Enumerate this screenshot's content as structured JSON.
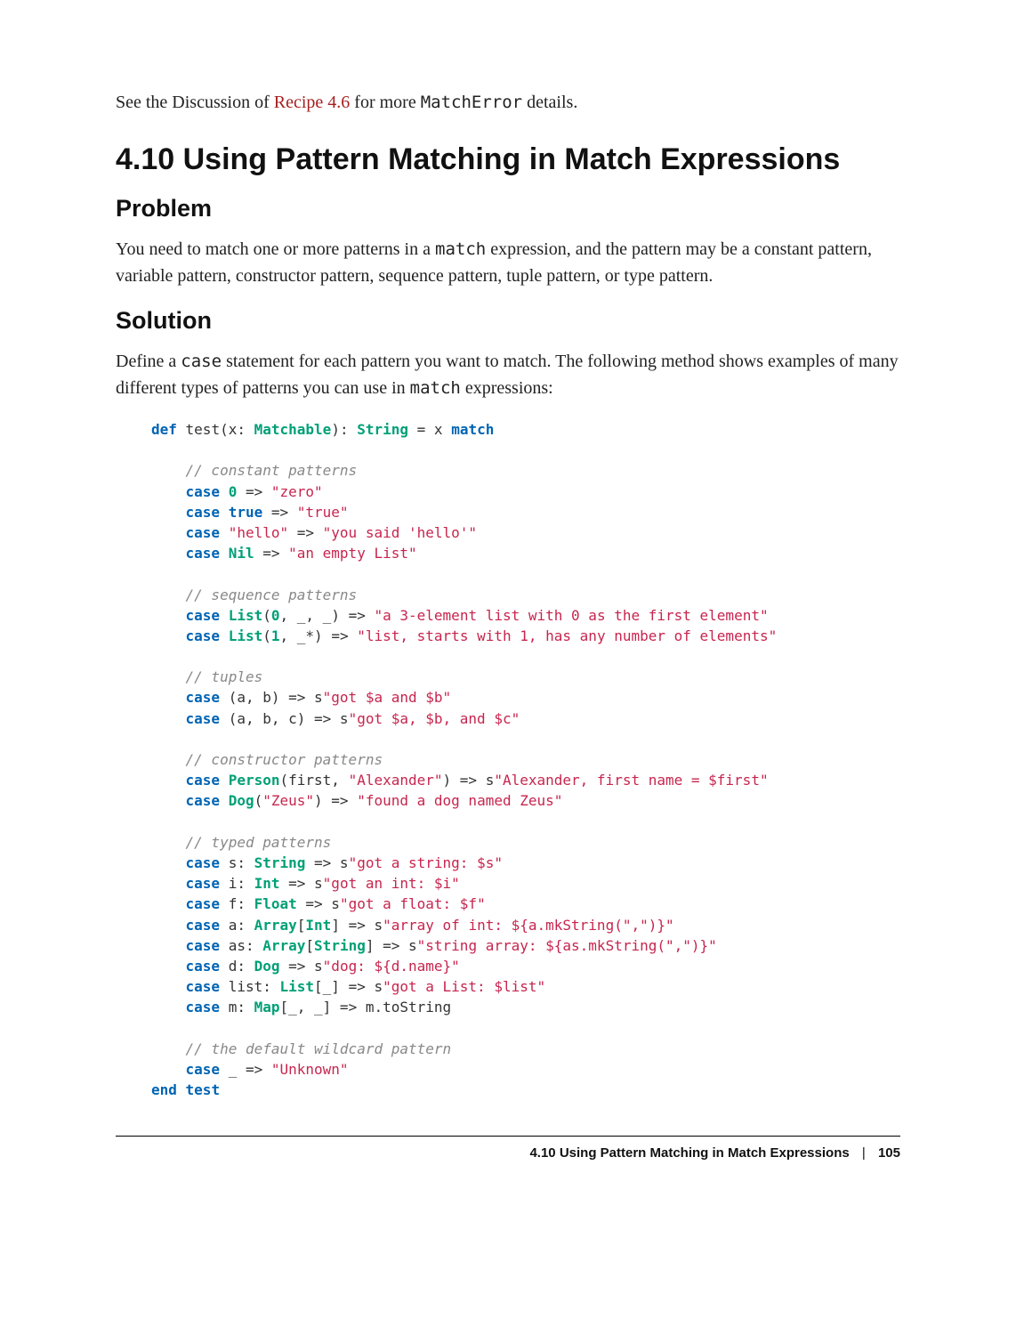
{
  "intro": {
    "prefix": "See the Discussion of ",
    "link": "Recipe 4.6",
    "mid": " for more ",
    "code": "MatchError",
    "suffix": " details."
  },
  "section": {
    "title": "4.10 Using Pattern Matching in Match Expressions"
  },
  "problem": {
    "heading": "Problem",
    "text_a": "You need to match one or more patterns in a ",
    "code": "match",
    "text_b": " expression, and the pattern may be a constant pattern, variable pattern, constructor pattern, sequence pattern, tuple pattern, or type pattern."
  },
  "solution": {
    "heading": "Solution",
    "text_a": "Define a ",
    "code1": "case",
    "text_b": " statement for each pattern you want to match. The following method shows examples of many different types of patterns you can use in ",
    "code2": "match",
    "text_c": " expressions:"
  },
  "code": {
    "l1_def": "def",
    "l1_name": " test(x: ",
    "l1_matchable": "Matchable",
    "l1_colon": "): ",
    "l1_string": "String",
    "l1_eq": " = x ",
    "l1_match": "match",
    "cmt_constant": "// constant patterns",
    "c1_case": "case",
    "c1_num": " 0",
    "c1_arrow": " => ",
    "c1_str": "\"zero\"",
    "c2_case": "case",
    "c2_true": " true",
    "c2_arrow": " => ",
    "c2_str": "\"true\"",
    "c3_case": "case",
    "c3_hello": " \"hello\"",
    "c3_arrow": " => ",
    "c3_str": "\"you said 'hello'\"",
    "c4_case": "case",
    "c4_nil": " Nil",
    "c4_arrow": " => ",
    "c4_str": "\"an empty List\"",
    "cmt_seq": "// sequence patterns",
    "s1_case": "case",
    "s1_list": " List",
    "s1_args": "(",
    "s1_zero": "0",
    "s1_rest": ", _, _) => ",
    "s1_str": "\"a 3-element list with 0 as the first element\"",
    "s2_case": "case",
    "s2_list": " List",
    "s2_args": "(",
    "s2_one": "1",
    "s2_rest": ", _*) => ",
    "s2_str": "\"list, starts with 1, has any number of elements\"",
    "cmt_tuples": "// tuples",
    "t1_case": "case",
    "t1_pat": " (a, b) => s",
    "t1_str": "\"got $a and $b\"",
    "t2_case": "case",
    "t2_pat": " (a, b, c) => s",
    "t2_str": "\"got $a, $b, and $c\"",
    "cmt_ctor": "// constructor patterns",
    "p1_case": "case",
    "p1_person": " Person",
    "p1_args": "(first, ",
    "p1_alex": "\"Alexander\"",
    "p1_close": ") => s",
    "p1_str": "\"Alexander, first name = $first\"",
    "p2_case": "case",
    "p2_dog": " Dog",
    "p2_open": "(",
    "p2_zeus": "\"Zeus\"",
    "p2_close": ") => ",
    "p2_str": "\"found a dog named Zeus\"",
    "cmt_typed": "// typed patterns",
    "ty1_case": "case",
    "ty1_var": " s: ",
    "ty1_type": "String",
    "ty1_arrow": " => s",
    "ty1_str": "\"got a string: $s\"",
    "ty2_case": "case",
    "ty2_var": " i: ",
    "ty2_type": "Int",
    "ty2_arrow": " => s",
    "ty2_str": "\"got an int: $i\"",
    "ty3_case": "case",
    "ty3_var": " f: ",
    "ty3_type": "Float",
    "ty3_arrow": " => s",
    "ty3_str": "\"got a float: $f\"",
    "ty4_case": "case",
    "ty4_var": " a: ",
    "ty4_type": "Array",
    "ty4_param": "[",
    "ty4_int": "Int",
    "ty4_close": "] => s",
    "ty4_str": "\"array of int: ${a.mkString(\",\")}\"",
    "ty5_case": "case",
    "ty5_var": " as: ",
    "ty5_type": "Array",
    "ty5_param": "[",
    "ty5_string": "String",
    "ty5_close": "] => s",
    "ty5_str": "\"string array: ${as.mkString(\",\")}\"",
    "ty6_case": "case",
    "ty6_var": " d: ",
    "ty6_type": "Dog",
    "ty6_arrow": " => s",
    "ty6_str": "\"dog: ${d.name}\"",
    "ty7_case": "case",
    "ty7_var": " list: ",
    "ty7_type": "List",
    "ty7_param": "[_] => s",
    "ty7_str": "\"got a List: $list\"",
    "ty8_case": "case",
    "ty8_var": " m: ",
    "ty8_type": "Map",
    "ty8_param": "[_, _] => m.toString",
    "cmt_default": "// the default wildcard pattern",
    "d1_case": "case",
    "d1_pat": " _ => ",
    "d1_str": "\"Unknown\"",
    "end": "end",
    "end_test": " test"
  },
  "footer": {
    "title": "4.10 Using Pattern Matching in Match Expressions",
    "sep": "|",
    "page": "105"
  }
}
